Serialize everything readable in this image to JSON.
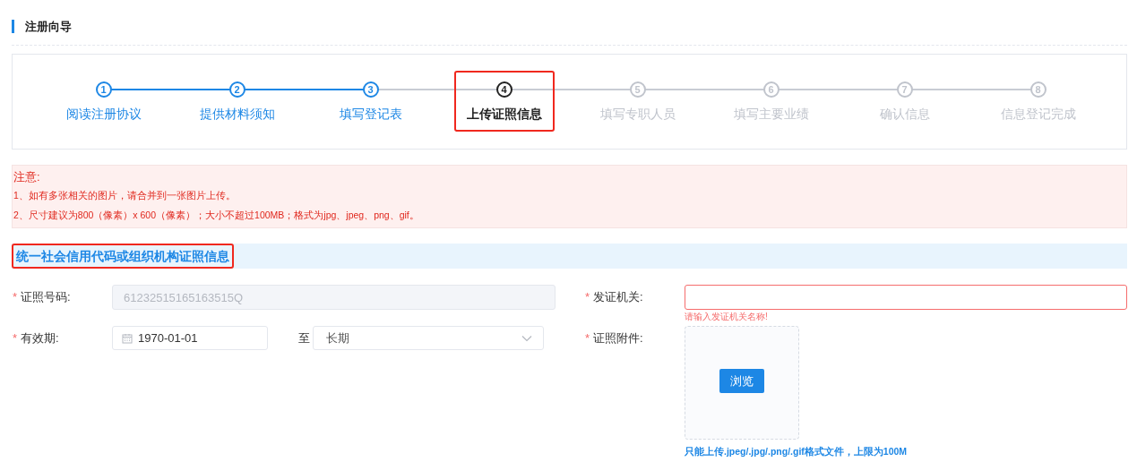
{
  "page_title": "注册向导",
  "steps": [
    {
      "number": "1",
      "label": "阅读注册协议",
      "completed": true,
      "active": false,
      "highlighted": false
    },
    {
      "number": "2",
      "label": "提供材料须知",
      "completed": true,
      "active": false,
      "highlighted": false
    },
    {
      "number": "3",
      "label": "填写登记表",
      "completed": true,
      "active": false,
      "highlighted": false
    },
    {
      "number": "4",
      "label": "上传证照信息",
      "completed": false,
      "active": true,
      "highlighted": true
    },
    {
      "number": "5",
      "label": "填写专职人员",
      "completed": false,
      "active": false,
      "highlighted": false
    },
    {
      "number": "6",
      "label": "填写主要业绩",
      "completed": false,
      "active": false,
      "highlighted": false
    },
    {
      "number": "7",
      "label": "确认信息",
      "completed": false,
      "active": false,
      "highlighted": false
    },
    {
      "number": "8",
      "label": "信息登记完成",
      "completed": false,
      "active": false,
      "highlighted": false
    }
  ],
  "notice": {
    "title": "注意:",
    "lines": [
      "1、如有多张相关的图片，请合并到一张图片上传。",
      "2、尺寸建议为800（像素）x 600（像素）；大小不超过100MB；格式为jpg、jpeg、png、gif。"
    ]
  },
  "section": {
    "title": "统一社会信用代码或组织机构证照信息",
    "highlighted": true
  },
  "left_fields": [
    {
      "kind": "text",
      "required_mark": "*",
      "label": "证照号码:",
      "value": "61232515165163515Q",
      "disabled": true
    },
    {
      "kind": "date-range",
      "required_mark": "*",
      "label": "有效期:",
      "value": "1970-01-01",
      "separator": "至",
      "end_value": "长期"
    }
  ],
  "right_fields": [
    {
      "kind": "text",
      "required_mark": "*",
      "label": "发证机关:",
      "disabled": false,
      "error": "请输入发证机关名称!"
    },
    {
      "kind": "upload",
      "required_mark": "*",
      "label": "证照附件:",
      "button": "浏览",
      "hint": "只能上传.jpeg/.jpg/.png/.gif格式文件，上限为100M"
    }
  ]
}
